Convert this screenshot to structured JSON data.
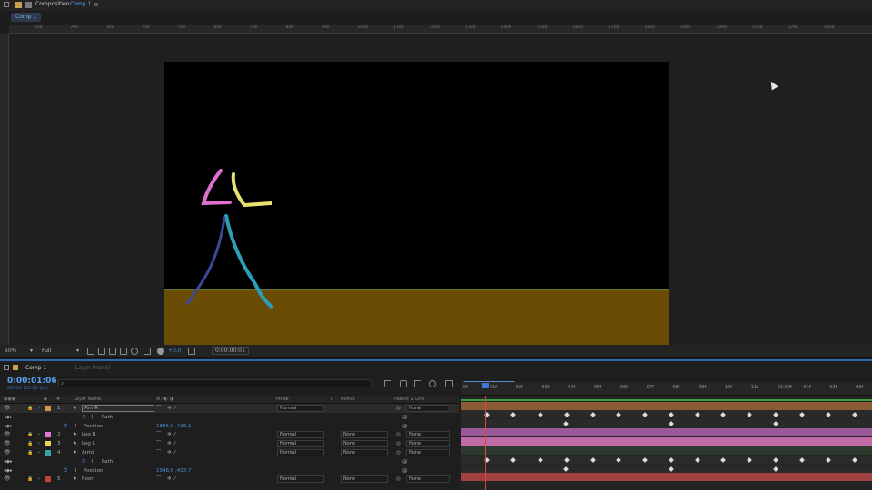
{
  "panel": {
    "title": "Composition",
    "comp_name": "Comp 1",
    "comp_tab": "Comp 1"
  },
  "ruler": {
    "top_labels": [
      "100",
      "200",
      "300",
      "400",
      "500",
      "600",
      "700",
      "800",
      "900",
      "1000",
      "1100",
      "1200",
      "1300",
      "1400",
      "1500",
      "1600",
      "1700",
      "1800",
      "1900",
      "2000",
      "2100",
      "2200",
      "2300"
    ]
  },
  "viewer_toolbar": {
    "zoom": "50%",
    "resolution": "Full",
    "exposure": "+0,0",
    "timecode": "0:00:00:01"
  },
  "timeline": {
    "tab": "Comp 1",
    "layer_tab": "Layer (none)",
    "timecode": "0:00:01:06",
    "fps": "00030 (25.00 fps)",
    "search_placeholder": "",
    "columns": {
      "layer_name": "Layer Name",
      "mode": "Mode",
      "t": "T",
      "trkmat": "TrkMat",
      "parent": "Parent & Link"
    },
    "ruler_labels": [
      "0f",
      "01f",
      "02f",
      "03f",
      "04f",
      "05f",
      "06f",
      "07f",
      "08f",
      "09f",
      "10f",
      "11f",
      "01:00f",
      "01f",
      "02f",
      "03f"
    ],
    "layers": [
      {
        "num": "1",
        "name": "ArmR",
        "mode": "Normal",
        "trkmat": "",
        "parent": "None",
        "color": "#d9954a",
        "selected": true
      },
      {
        "num": "",
        "name": "Path",
        "kind": "sub"
      },
      {
        "num": "",
        "name": "Position",
        "kind": "prop",
        "value": "1885,0 ,418,1"
      },
      {
        "num": "2",
        "name": "Leg R",
        "mode": "Normal",
        "trkmat": "None",
        "parent": "None",
        "color": "#e07ad0"
      },
      {
        "num": "3",
        "name": "Leg L",
        "mode": "Normal",
        "trkmat": "None",
        "parent": "None",
        "color": "#e8d060"
      },
      {
        "num": "4",
        "name": "ArmL",
        "mode": "Normal",
        "trkmat": "None",
        "parent": "None",
        "color": "#3aa0a8"
      },
      {
        "num": "",
        "name": "Path",
        "kind": "sub"
      },
      {
        "num": "",
        "name": "Position",
        "kind": "prop",
        "value": "1948,6 ,413,7"
      },
      {
        "num": "5",
        "name": "floor",
        "mode": "Normal",
        "trkmat": "None",
        "parent": "None",
        "color": "#c24040"
      }
    ]
  },
  "colors": {
    "accent": "#2a66b0",
    "timecode": "#5aa0f0",
    "floor": "#6b4c05",
    "playhead": "#d84a3a",
    "armR": "#e070d0",
    "armL": "#e8e070",
    "legR": "#2aa0b8",
    "legL": "#3a4a9a"
  }
}
